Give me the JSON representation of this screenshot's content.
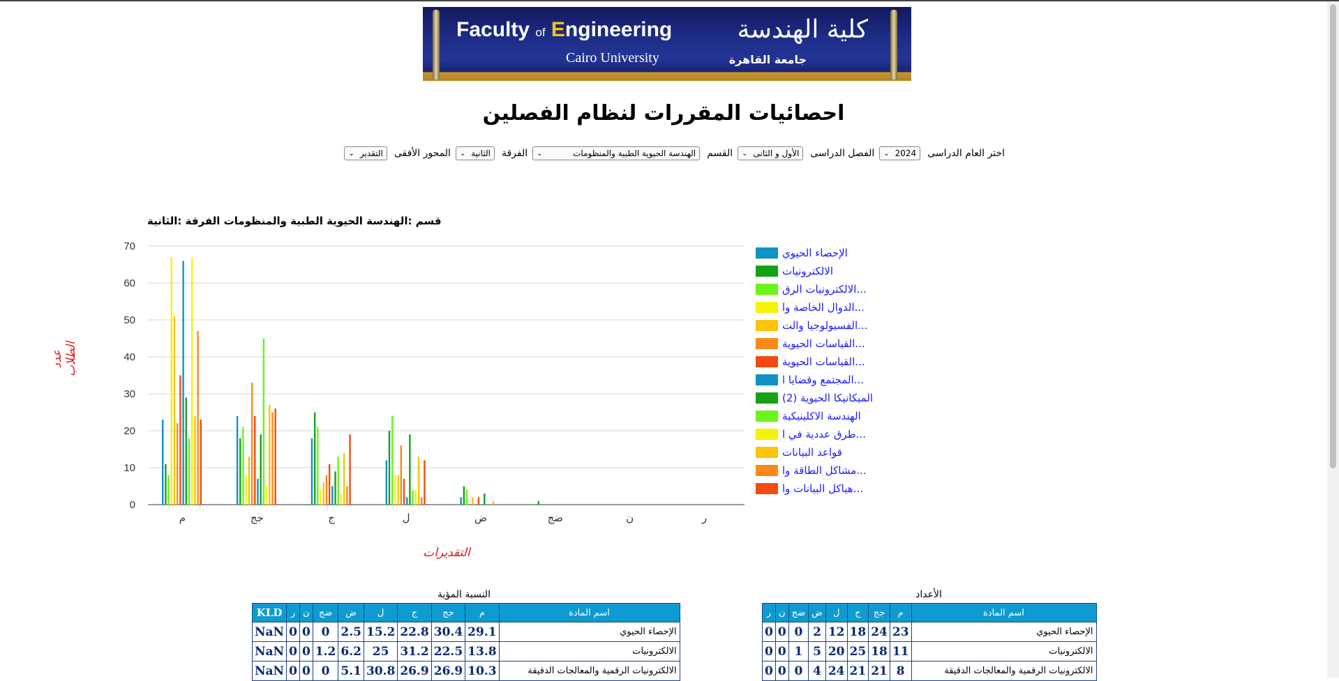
{
  "banner": {
    "en_title_1": "Faculty",
    "en_title_of": "of",
    "en_title_e": "E",
    "en_title_2": "ngineering",
    "en_sub": "Cairo University",
    "ar_title": "كلية الهندسة",
    "ar_sub": "جامعة القاهرة"
  },
  "page_title": "احصائيات المقررات لنظام الفصلين",
  "filters": {
    "year_label": "اختر العام الدراسى",
    "year_value": "2024",
    "semester_label": "الفصل الدراسى",
    "semester_value": "الأول و الثانى",
    "dept_label": "القسم",
    "dept_value": "الهندسة الحيوية الطبية والمنظومات",
    "level_label": "الفرقة",
    "level_value": "الثانية",
    "axis_label": "المحور الأفقى",
    "axis_value": "التقدير"
  },
  "chart_data": {
    "type": "bar",
    "title": "قسم :الهندسة الحيوية الطبية والمنظومات الفرقة :الثانية",
    "xlabel": "التقديرات",
    "ylabel": "عدد الطلاب",
    "ylim": [
      0,
      70
    ],
    "yticks": [
      0,
      10,
      20,
      30,
      40,
      50,
      60,
      70
    ],
    "grid": true,
    "legend_position": "right",
    "categories": [
      "م",
      "جج",
      "ج",
      "ل",
      "ض",
      "ضج",
      "ن",
      "ر"
    ],
    "series": [
      {
        "name": "الإحصاء الحيوي",
        "color": "#1192c7",
        "values": [
          23,
          24,
          18,
          12,
          2,
          0,
          0,
          0
        ]
      },
      {
        "name": "الالكترونيات",
        "color": "#16a116",
        "values": [
          11,
          18,
          25,
          20,
          5,
          1,
          0,
          0
        ]
      },
      {
        "name": "الالكترونيات الرق...",
        "color": "#6cf31c",
        "values": [
          8,
          21,
          21,
          24,
          4,
          0,
          0,
          0
        ]
      },
      {
        "name": "الدوال الخاصة وا...",
        "color": "#f3f30c",
        "values": [
          67,
          8,
          4,
          8,
          0,
          0,
          0,
          0
        ]
      },
      {
        "name": "الفسيولوجيا والت...",
        "color": "#f9c409",
        "values": [
          51,
          13,
          6,
          8,
          2,
          0,
          0,
          0
        ]
      },
      {
        "name": "القياسات الحيوية...",
        "color": "#f98a1a",
        "values": [
          22,
          33,
          8,
          16,
          0,
          0,
          0,
          0
        ]
      },
      {
        "name": "القياسات الحيوية...",
        "color": "#f34b0f",
        "values": [
          35,
          24,
          11,
          7,
          2,
          0,
          0,
          0
        ]
      },
      {
        "name": "المجتمع وقضايا ا...",
        "color": "#1192c7",
        "values": [
          66,
          7,
          5,
          2,
          0,
          0,
          0,
          0
        ]
      },
      {
        "name": "الميكانيكا الحيوية (2)",
        "color": "#16a116",
        "values": [
          29,
          19,
          9,
          19,
          3,
          0,
          0,
          0
        ]
      },
      {
        "name": "الهندسة الاكلينيكية",
        "color": "#6cf31c",
        "values": [
          18,
          45,
          13,
          4,
          0,
          0,
          0,
          0
        ]
      },
      {
        "name": "طرق عددية في ا...",
        "color": "#f3f30c",
        "values": [
          67,
          5,
          3,
          4,
          0,
          0,
          0,
          0
        ]
      },
      {
        "name": "قواعد البيانات",
        "color": "#f9c409",
        "values": [
          24,
          27,
          14,
          13,
          1,
          0,
          0,
          0
        ]
      },
      {
        "name": "مشاكل الطاقة وا...",
        "color": "#f98a1a",
        "values": [
          47,
          25,
          5,
          2,
          0,
          0,
          0,
          0
        ]
      },
      {
        "name": "هياكل البيانات وا...",
        "color": "#f34b0f",
        "values": [
          23,
          26,
          19,
          12,
          0,
          0,
          0,
          0
        ]
      }
    ]
  },
  "table_counts": {
    "title": "الأعداد",
    "headers": [
      "اسم المادة",
      "م",
      "جج",
      "ج",
      "ل",
      "ض",
      "ضج",
      "ن",
      "ر"
    ],
    "rows": [
      [
        "الإحصاء الحيوي",
        "23",
        "24",
        "18",
        "12",
        "2",
        "0",
        "0",
        "0"
      ],
      [
        "الالكترونيات",
        "11",
        "18",
        "25",
        "20",
        "5",
        "1",
        "0",
        "0"
      ],
      [
        "الالكترونيات الرقمية والمعالجات الدقيقة",
        "8",
        "21",
        "21",
        "24",
        "4",
        "0",
        "0",
        "0"
      ]
    ]
  },
  "table_percent": {
    "title": "النسبة المؤية",
    "headers": [
      "اسم المادة",
      "م",
      "جج",
      "ج",
      "ل",
      "ض",
      "ضج",
      "ن",
      "ر",
      "KLD"
    ],
    "rows": [
      [
        "الإحصاء الحيوي",
        "29.1",
        "30.4",
        "22.8",
        "15.2",
        "2.5",
        "0",
        "0",
        "0",
        "NaN"
      ],
      [
        "الالكترونيات",
        "13.8",
        "22.5",
        "31.2",
        "25",
        "6.2",
        "1.2",
        "0",
        "0",
        "NaN"
      ],
      [
        "الالكترونيات الرقمية والمعالجات الدقيقة",
        "10.3",
        "26.9",
        "26.9",
        "30.8",
        "5.1",
        "0",
        "0",
        "0",
        "NaN"
      ]
    ]
  }
}
